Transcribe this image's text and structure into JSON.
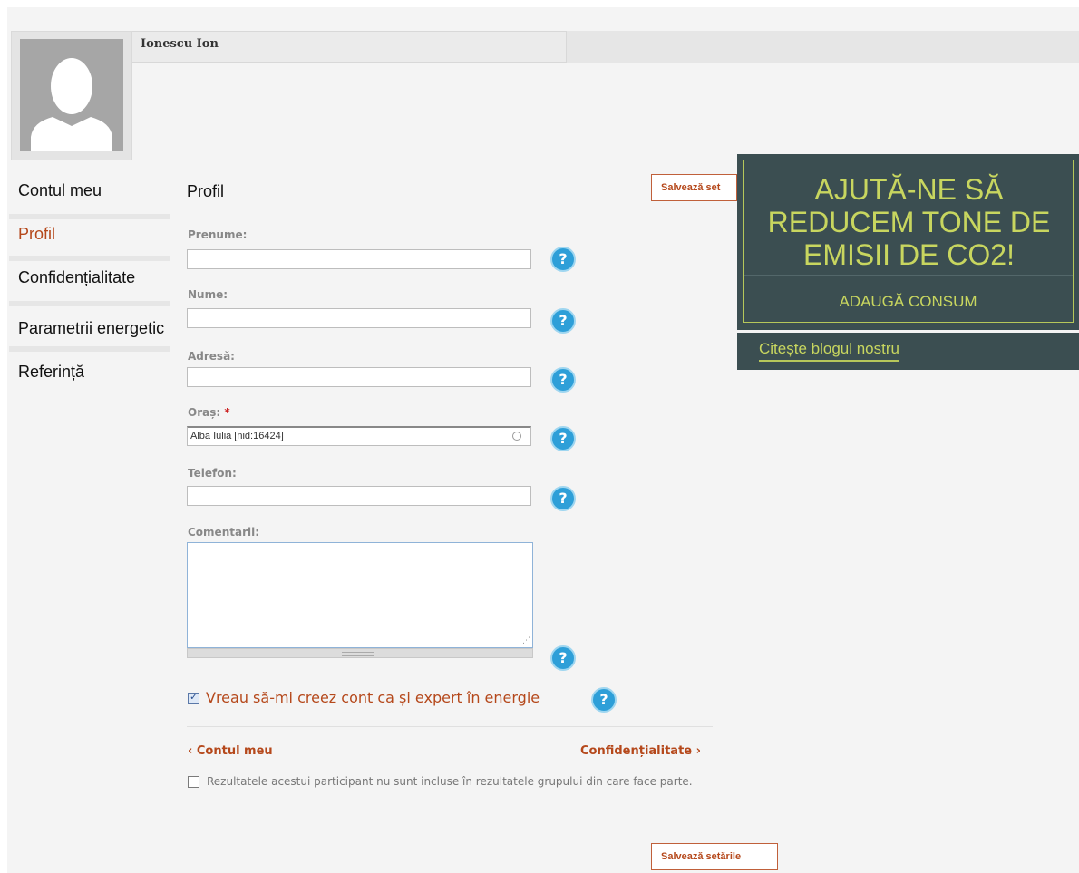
{
  "user": {
    "name": "Ionescu Ion"
  },
  "nav": {
    "items": [
      {
        "label": "Contul meu"
      },
      {
        "label": "Profil"
      },
      {
        "label": "Confidențialitate"
      },
      {
        "label": "Parametrii energetic"
      },
      {
        "label": "Referință"
      }
    ]
  },
  "form": {
    "title": "Profil",
    "fields": {
      "prenume": {
        "label": "Prenume:",
        "value": ""
      },
      "nume": {
        "label": "Nume:",
        "value": ""
      },
      "adresa": {
        "label": "Adresă:",
        "value": ""
      },
      "oras": {
        "label": "Oraș:",
        "required_mark": "*",
        "value": "Alba Iulia [nid:16424]"
      },
      "telefon": {
        "label": "Telefon:",
        "value": ""
      },
      "comentarii": {
        "label": "Comentarii:",
        "value": ""
      }
    },
    "help_glyph": "?",
    "expert_checkbox": {
      "label": "Vreau să-mi creez cont ca și expert în energie",
      "checked": true
    },
    "pager": {
      "prev": "‹ Contul meu",
      "next": "Confidențialitate ›"
    },
    "exclude_checkbox": {
      "label": "Rezultatele acestui participant nu sunt incluse în rezultatele grupului din care face parte.",
      "checked": false
    },
    "save_top_label": "Salvează set",
    "save_label": "Salvează setările"
  },
  "promo": {
    "headline": "AJUTĂ-NE SĂ REDUCEM TONE DE EMISII DE CO2!",
    "cta": "ADAUGĂ CONSUM",
    "blog_link": "Citește blogul nostru"
  },
  "colors": {
    "accent": "#b5481b",
    "promo_bg": "#3b4e51",
    "promo_text": "#c8d65f",
    "help_icon": "#2e9fd8"
  }
}
